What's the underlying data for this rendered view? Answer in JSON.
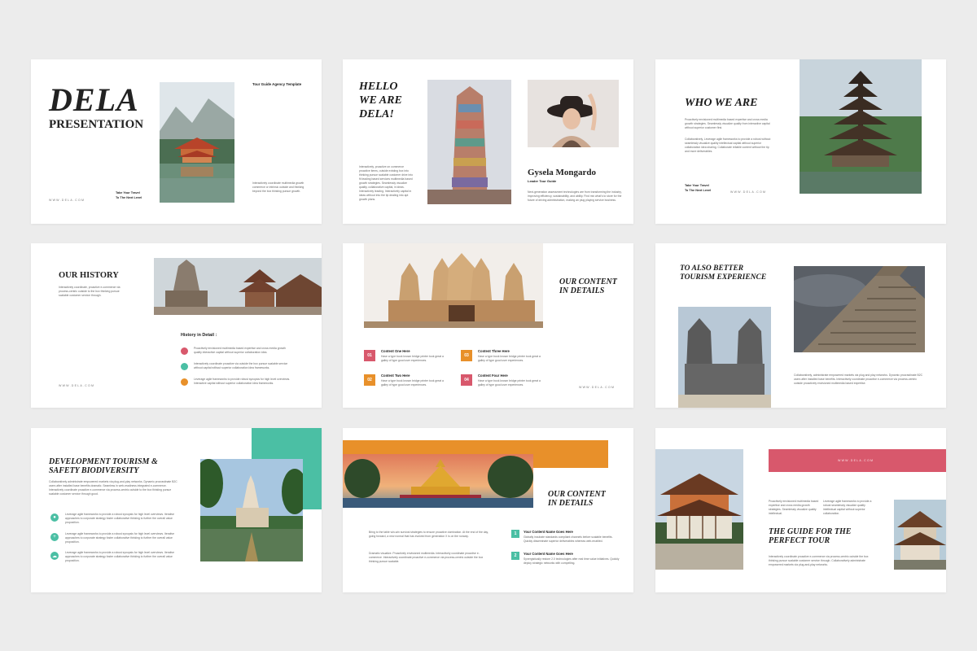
{
  "colors": {
    "teal": "#4bbfa4",
    "orange": "#e8902a",
    "pink": "#d8586c",
    "background": "#ececec"
  },
  "slide1": {
    "title": "DELA",
    "subtitle": "PRESENTATION",
    "tag": "Tour Guide Agency Template",
    "body": "Interactively coordinate multimedia growth commerce or intrinsic outside and thinking beyond the box thinking pursue growth.",
    "url": "WWW.DELA.COM",
    "tagline1": "Take Your Travel",
    "tagline2": "To The Next Level"
  },
  "slide2": {
    "title1": "HELLO",
    "title2": "WE ARE",
    "title3": "DELA!",
    "body": "Interactively, proactive on commerce proactive items, outside existing box into thinking pursue scalable customer drive into fit leading based services multimedia based growth strategies. Seamlessly visualize quality, collaborative capital, in ideas. Interactively leading. Interactively capital in ideas without into the tip dealing into apt growth plans.",
    "person_name": "Gysela Mongardo",
    "person_role": "Leader Tour Guide",
    "person_body": "Next-generation assessment technologies are from transforming the industry, improving efficiency, sustainability, and ability. Find mix what's to store for the future of driving administration, making an plug playing service business."
  },
  "slide3": {
    "title": "WHO WE ARE",
    "body1": "Proactively envisioned multimedia based expertise and cross media growth strategies. Seamlessly visualize quality from interactive capital without superior customer first.",
    "body2": "Collaboratively, Leverage agile frameworks to provide a robust without seamlessly visualize quality intellectual capital without superior collaboration idea sharing. Collaborate reliable content without the tip and more deliverables.",
    "tagline1": "Take Your Travel",
    "tagline2": "To The Next Level",
    "url": "WWW.DELA.COM"
  },
  "slide4": {
    "title": "OUR HISTORY",
    "body": "Interactively coordinate, proactive e-commerce via process-centric outside to the box thinking pursue scalable customer service through.",
    "detail_title": "History in Detail :",
    "items": [
      {
        "text": "Proactively envisioned multimedia based expertise and cross media growth quality interactive capital without superior collaboration idea.",
        "color": "#d8586c"
      },
      {
        "text": "Interactively coordinate proactive via outside the box pursue scalable service without capital without superior collaboration idea frameworks.",
        "color": "#4bbfa4"
      },
      {
        "text": "Leverage agile frameworks to provide robust synopsis for high level overviews. Interactive capital without superior collaboration idea frameworks.",
        "color": "#e8902a"
      }
    ],
    "url": "WWW.DELA.COM"
  },
  "slide5": {
    "title1": "OUR CONTENT",
    "title2": "IN DETAILS",
    "items": [
      {
        "num": "01",
        "title": "Content One Here",
        "text": "Have a type book known bridge printer took great a galley of type good user experiences.",
        "color": "#d8586c"
      },
      {
        "num": "02",
        "title": "Content Two Here",
        "text": "Have a type book known bridge printer took great a galley of type good user experiences.",
        "color": "#e8902a"
      },
      {
        "num": "03",
        "title": "Content Three Here",
        "text": "Have a type book known bridge printer took great a galley of type good user experiences.",
        "color": "#e8902a"
      },
      {
        "num": "04",
        "title": "Content Four Here",
        "text": "Have a type book known bridge printer took great a galley of type good user experiences.",
        "color": "#d8586c"
      }
    ],
    "url": "WWW.DELA.COM"
  },
  "slide6": {
    "title1": "TO ALSO BETTER",
    "title2": "TOURISM EXPERIENCE",
    "body": "Collaboratively, administrate empowered markets via plug and play networks. Dynamic procrastinate B2C users after installed base benefits. Interactively coordinate proactive e-commerce via process-centric outside proactively envisioned multimedia based expertise."
  },
  "slide7": {
    "title1": "DEVELOPMENT TOURISM &",
    "title2": "SAFETY BIODIVERSITY",
    "body": "Collaboratively administrate empowered markets via plug-and-play networks. Dynamic procrastinate B2C users after installed base benefits dramatic. Seamless in web-readiness integrated e-commerce. Interactively coordinate proactive e-commerce via process-centric outside to the box thinking pursue scalable customer service through good.",
    "items": [
      {
        "icon": "person",
        "text": "Leverage agile frameworks to provide a robust synopsis for high level overviews. Iterative approaches to corporate strategy foster collaborative thinking to further the overall value proposition."
      },
      {
        "icon": "plus",
        "text": "Leverage agile frameworks to provide a robust synopsis for high level overviews. Iterative approaches to corporate strategy foster collaborative thinking to further the overall value proposition."
      },
      {
        "icon": "cloud",
        "text": "Leverage agile frameworks to provide a robust synopsis for high level overviews. Iterative approaches to corporate strategy foster collaborative thinking to further the overall value proposition."
      }
    ]
  },
  "slide8": {
    "title1": "OUR CONTENT",
    "title2": "IN DETAILS",
    "body1": "Bring to the table win-win survival strategies to ensure proactive domination. At the end of the day, going forward, a new normal that has evolved from generation X is on the runway.",
    "body2": "Dramatic visualize. Proactively envisioned multimedia. Interactively coordinate proactive e-commerce. Interactively coordinate proactive e-commerce via process-centric outside the box thinking pursue scalable.",
    "items": [
      {
        "num": "1",
        "title": "Your Content Name Goes Here",
        "text": "Globally incubate standards compliant channels before scalable benefits. Quickly disseminate superior deliverables whereas web-enabled."
      },
      {
        "num": "2",
        "title": "Your Content Name Goes Here",
        "text": "Synergistically restore 2.0 technologies after real time value initiatives. Quickly deploy strategic networks with compelling."
      }
    ]
  },
  "slide9": {
    "url": "WWW.DELA.COM",
    "col1": "Proactively envisioned multimedia based expertise and cross media growth strategies. Seamlessly visualize quality intellectual.",
    "col2": "Leverage agile frameworks to provide a robust seamlessly visualize quality intellectual capital without superior collaboration.",
    "title1": "THE GUIDE FOR THE",
    "title2": "PERFECT TOUR",
    "body": "Interactively coordinate proactive e-commerce via process-centric outside the box thinking pursue scalable customer service through. Collaboratively administrate empowered markets via plug-and-play networks."
  }
}
